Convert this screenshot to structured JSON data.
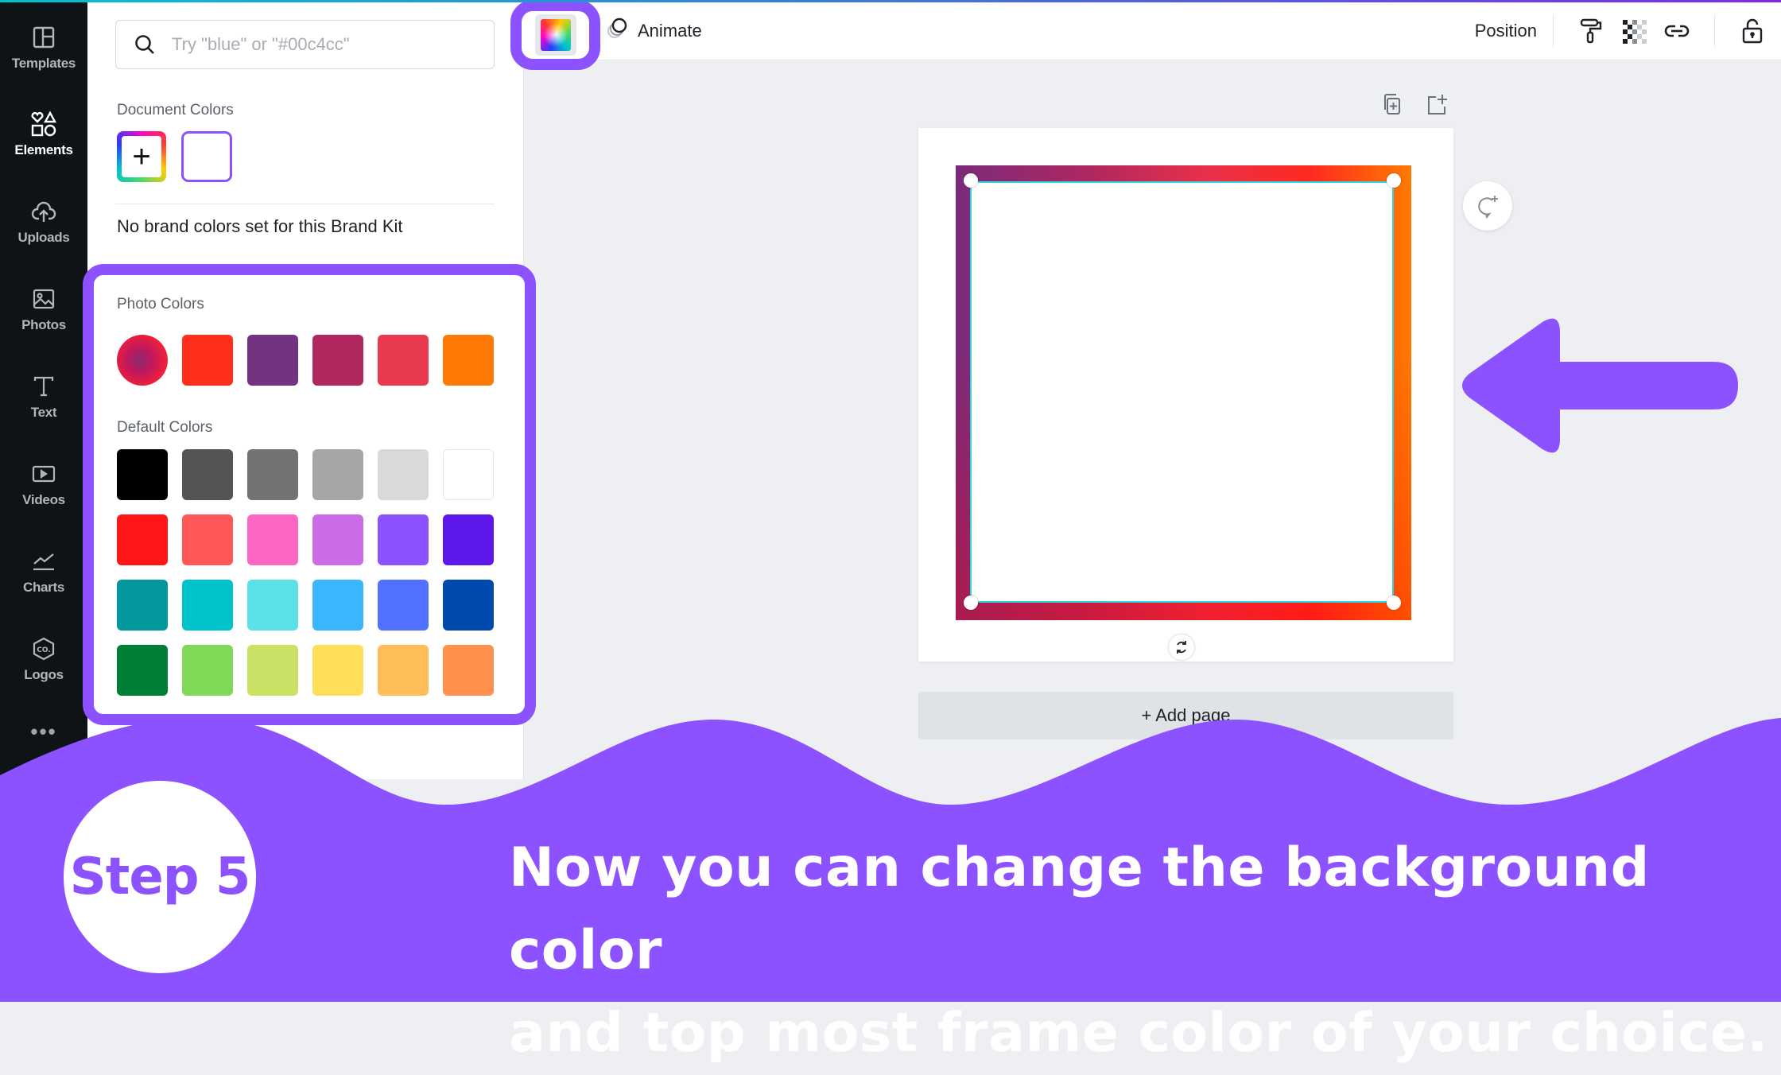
{
  "sidebar": {
    "items": [
      {
        "label": "Templates",
        "icon": "templates-icon",
        "active": false
      },
      {
        "label": "Elements",
        "icon": "elements-icon",
        "active": true
      },
      {
        "label": "Uploads",
        "icon": "upload-cloud-icon",
        "active": false
      },
      {
        "label": "Photos",
        "icon": "photo-icon",
        "active": false
      },
      {
        "label": "Text",
        "icon": "text-icon",
        "active": false
      },
      {
        "label": "Videos",
        "icon": "video-icon",
        "active": false
      },
      {
        "label": "Charts",
        "icon": "chart-icon",
        "active": false
      },
      {
        "label": "Logos",
        "icon": "logo-icon",
        "active": false
      }
    ],
    "more_label": "•••"
  },
  "panel": {
    "search_placeholder": "Try \"blue\" or \"#00c4cc\"",
    "document_colors_title": "Document Colors",
    "document_colors": [
      {
        "type": "add",
        "label": "+"
      },
      {
        "type": "color",
        "hex": "#ffffff"
      }
    ],
    "brand_note": "No brand colors set for this Brand Kit",
    "photo_colors_title": "Photo Colors",
    "photo_colors": [
      "photo",
      "#ff2f1c",
      "#733381",
      "#b0285f",
      "#e8394f",
      "#ff7a05"
    ],
    "default_colors_title": "Default Colors",
    "default_colors": [
      [
        "#000000",
        "#545454",
        "#737373",
        "#a6a6a6",
        "#d9d9d9",
        "#ffffff"
      ],
      [
        "#ff1616",
        "#ff5757",
        "#ff66c4",
        "#cb6ce6",
        "#8c52ff",
        "#5e17eb"
      ],
      [
        "#03989e",
        "#00c2cb",
        "#5ce1e6",
        "#38b6ff",
        "#5271ff",
        "#004aad"
      ],
      [
        "#008037",
        "#7ed957",
        "#c9e265",
        "#ffde59",
        "#ffbd59",
        "#ff914d"
      ]
    ]
  },
  "toolbar": {
    "animate_label": "Animate",
    "position_label": "Position"
  },
  "canvas": {
    "add_page_label": "+ Add page"
  },
  "overlay": {
    "step_label": "Step 5",
    "caption_line1": "Now you can change the background color",
    "caption_line2": "and top most frame color of your choice.",
    "accent": "#8c52ff"
  }
}
